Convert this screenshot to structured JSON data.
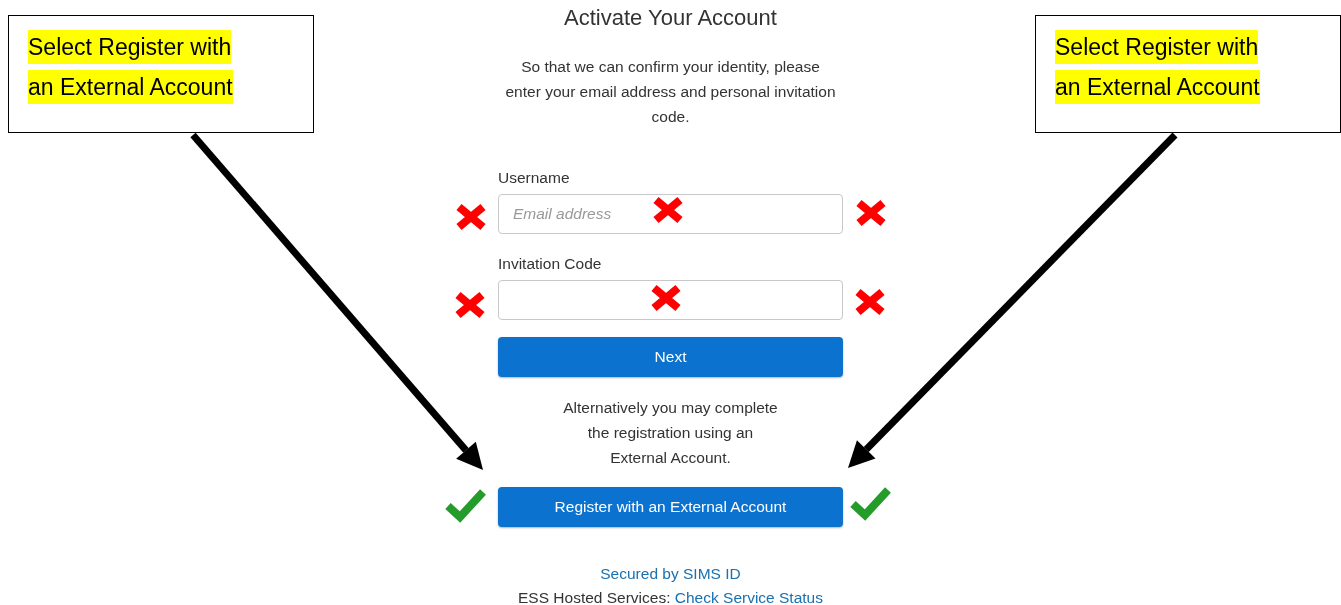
{
  "title": "Activate Your Account",
  "intro": "So that we can confirm your identity, please enter your email address and personal invitation code.",
  "fields": [
    {
      "label": "Username",
      "placeholder": "Email address"
    },
    {
      "label": "Invitation Code"
    }
  ],
  "next_button": "Next",
  "alternative_text": "Alternatively you may complete the registration using an External Account.",
  "external_button": "Register with an External Account",
  "footer": {
    "secured_link": "Secured by SIMS ID",
    "hosted_label": "ESS Hosted Services:",
    "status_link": "Check Service Status"
  },
  "callouts": [
    {
      "lines": [
        "Select Register with",
        "an External Account"
      ]
    },
    {
      "lines": [
        "Select Register with",
        "an External Account"
      ]
    }
  ],
  "marks": [
    {
      "kind": "cross"
    },
    {
      "kind": "cross"
    },
    {
      "kind": "cross"
    },
    {
      "kind": "cross"
    },
    {
      "kind": "cross"
    },
    {
      "kind": "cross"
    },
    {
      "kind": "check"
    },
    {
      "kind": "check"
    }
  ]
}
